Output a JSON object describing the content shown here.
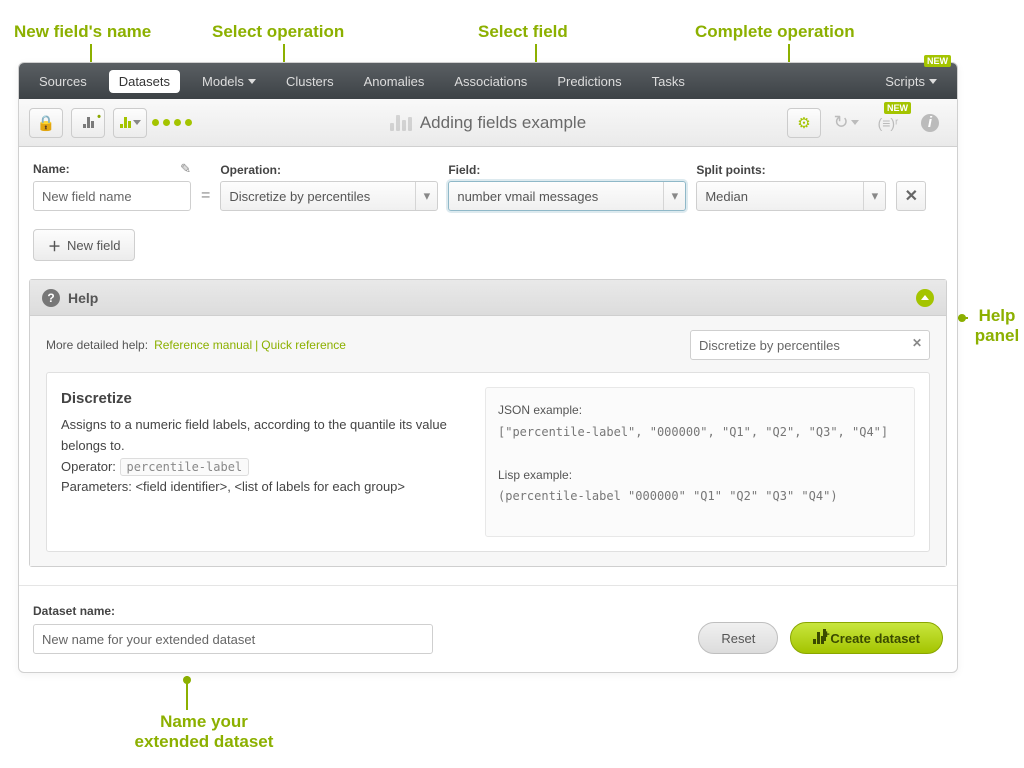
{
  "callouts": {
    "new_field_name": "New field's name",
    "select_operation": "Select operation",
    "select_field": "Select field",
    "complete_operation": "Complete operation",
    "help_panel": "Help panel",
    "name_extended": "Name your extended dataset"
  },
  "nav": {
    "sources": "Sources",
    "datasets": "Datasets",
    "models": "Models",
    "clusters": "Clusters",
    "anomalies": "Anomalies",
    "associations": "Associations",
    "predictions": "Predictions",
    "tasks": "Tasks",
    "scripts": "Scripts",
    "new_badge": "NEW"
  },
  "title": "Adding fields example",
  "form": {
    "name_label": "Name:",
    "name_value": "New field name",
    "eq": "=",
    "operation_label": "Operation:",
    "operation_value": "Discretize by percentiles",
    "field_label": "Field:",
    "field_value": "number vmail messages",
    "split_label": "Split points:",
    "split_value": "Median"
  },
  "buttons": {
    "new_field": "New field",
    "reset": "Reset",
    "create": "Create dataset"
  },
  "help": {
    "title": "Help",
    "more_label": "More detailed help:",
    "ref_manual": "Reference manual",
    "quick_ref": "Quick reference",
    "search_value": "Discretize by percentiles",
    "h4": "Discretize",
    "desc": "Assigns to a numeric field labels, according to the quantile its value belongs to.",
    "operator_label": "Operator:",
    "operator": "percentile-label",
    "params_label": "Parameters:",
    "params_value": "<field identifier>, <list of labels for each group>",
    "json_label": "JSON example:",
    "json_code": "[\"percentile-label\", \"000000\", \"Q1\", \"Q2\", \"Q3\", \"Q4\"]",
    "lisp_label": "Lisp example:",
    "lisp_code": "(percentile-label \"000000\" \"Q1\" \"Q2\" \"Q3\" \"Q4\")"
  },
  "footer": {
    "dataset_name_label": "Dataset name:",
    "dataset_name_value": "New name for your extended dataset"
  }
}
